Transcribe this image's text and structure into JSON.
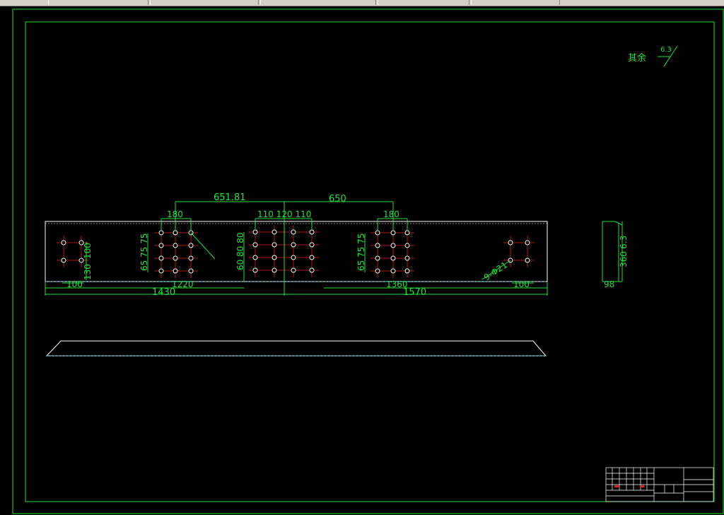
{
  "toolbar": {
    "segments": 6
  },
  "colors": {
    "frame": "#22e03a",
    "outline": "#ffffff",
    "centerline": "#e02020",
    "dimension": "#22e03a",
    "background": "#000000"
  },
  "surface_note": {
    "label": "其余",
    "roughness": "6.3"
  },
  "dimensions": {
    "top_left": "651.81",
    "top_right": "650",
    "group_left": "180",
    "group_mid": "110 120 110",
    "group_right": "180",
    "left_small_v": "100",
    "left_small_v2": "130",
    "left_v": "75 75",
    "left_v2": "65",
    "mid_v": "80 80",
    "mid_v2": "60",
    "right_v": "75 75",
    "right_v2": "65",
    "hole_note": "9-Φ21",
    "bottom_left_small": "100",
    "bottom_left_1220": "1220",
    "bottom_left_total": "1430",
    "bottom_right_1360": "1360",
    "bottom_right_total": "1570",
    "bottom_right_small": "100",
    "side_height": "360",
    "side_thick": "6.3",
    "side_width": "98"
  }
}
